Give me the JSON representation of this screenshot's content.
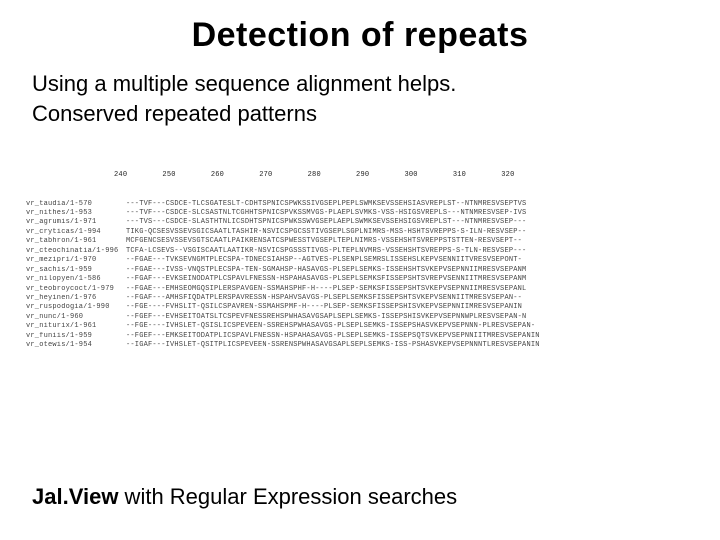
{
  "title": "Detection of repeats",
  "subtitle_line1": "Using a multiple sequence alignment helps.",
  "subtitle_line2": "Conserved repeated patterns",
  "footer_bold": "Jal.View",
  "footer_rest": " with Regular Expression searches",
  "ruler": "                    240        250        260        270        280        290        300        310        320",
  "rows": [
    {
      "label": "vr_taudia/1-570",
      "seq": "---TVF---CSDCE-TLCSGATESLT-CDHTSPNICSPWKSSIVGSEPLPEPLSWMKSEVSSEHSIASVREPLST--NTNMRESVSEPTVS"
    },
    {
      "label": "vr_nithes/1-953",
      "seq": "---TVF---CSDCE-SLCSASTNLTCGHHTSPNICSPVKSSMVGS-PLAEPLSVMKS-VSS-HSIGSVREPLS---NTNMRESVSEP-IVS"
    },
    {
      "label": "vr_agrumis/1-971",
      "seq": "---TVS---CSDCE-SLASTHTNLICSDHTSPNICSPWKSSWVGSEPLAEPLSWMKSEVSSEHSIGSVREPLST---NTNMRESVSEP---"
    },
    {
      "label": "vr_cryticas/1-994",
      "seq": "TIKG-QCSESVSSEVSGICSAATLTASHIR-NSVICSPGCSSTIVGSEPLSGPLNIMRS-MSS-HSHTSVREPPS-S-ILN-RESVSEP--"
    },
    {
      "label": "vr_tabhron/1-961",
      "seq": "MCFGENCSESVSSEVSGTSCAATLPAIKRENSATCSPWESSTVGSEPLTEPLNIMRS-VSSEHSHTSVREPPSTSTTEN-RESVSEPT--"
    },
    {
      "label": "vr_cteochinatia/1-996",
      "seq": "TCFA-LCSEVS--VSGISCAATLAATIKR-NSVICSPGSSSTIVGS-PLTEPLNVMRS-VSSEHSHTSVREPPS-S-TLN-RESVSEP---"
    },
    {
      "label": "vr_mezipri/1-970",
      "seq": "--FGAE---TVKSEVNGMTPLECSPA-TDNECSIAHSP--AGTVES-PLSENPLSEMRSLISSEHSLKEPVSENNIITVRESVSEPONT-"
    },
    {
      "label": "vr_sachis/1-959",
      "seq": "--FGAE---IVSS-VNQSTPLECSPA-TEN-SGMAHSP-HASAVGS-PLSEPLSEMKS-ISSEHSHTSVKEPVSEPNNIIMRESVSEPANM"
    },
    {
      "label": "vr_nilopyen/1-586",
      "seq": "--FGAF---EVKSEINODATPLCSPAVLFNESSN-HSPAHASAVGS-PLSEPLSEMKSFISSEPSHTSVREPVSENNIITMRESVSEPANM"
    },
    {
      "label": "vr_teobroycoct/1-979",
      "seq": "--FGAE---EMHSEOMGQSIPLERSPAVGEN-SSMAHSPHF-H----PLSEP-SEMKSFISSEPSHTSVKEPVSEPNNIIMRESVSEPANL"
    },
    {
      "label": "vr_heyinen/1-976",
      "seq": "--FGAF---AMHSFIQDATPLERSPAVRESSN-HSPAHVSAVGS-PLSEPLSEMKSFISSEPSHTSVKEPVSENNIITMRESVSEPAN--"
    },
    {
      "label": "vr_ruspodogia/1-990",
      "seq": "--FGE----FVHSLIT-QSILCSPAVREN-SSMAHSPMF-H----PLSEP-SEMKSFISSEPSHISVKEPVSEPNNIIMRESVSEPANIN"
    },
    {
      "label": "vr_nunc/1-960",
      "seq": "--FGEF---EVHSEITOATSLTCSPEVFNESSREHSPWHASAVGSAPLSEPLSEMKS-ISSEPSHISVKEPVSEPNNWPLRESVSEPAN-N"
    },
    {
      "label": "vr_niturix/1-961",
      "seq": "--FGE----IVHSLET-QSISLICSPEVEEN-SSREHSPWHASAVGS-PLSEPLSEMKS-ISSEPSHASVKEPVSEPNNN-PLRESVSEPAN-"
    },
    {
      "label": "vr_funiis/1-959",
      "seq": "--FGEF---EMKSEITODATPLICSPAVLFNESSN-HSPAHASAVGS-PLSEPLSEMKS-ISSEPSQTSVKEPVSEPNNIITMRESVSEPANIN"
    },
    {
      "label": "vr_otewis/1-954",
      "seq": "--IGAF---IVHSLET-QSITPLICSPEVEEN-SSRENSPWHASAVGSAPLSEPLSEMKS-ISS-PSHASVKEPVSEPNNNTLRESVSEPANIN"
    }
  ]
}
